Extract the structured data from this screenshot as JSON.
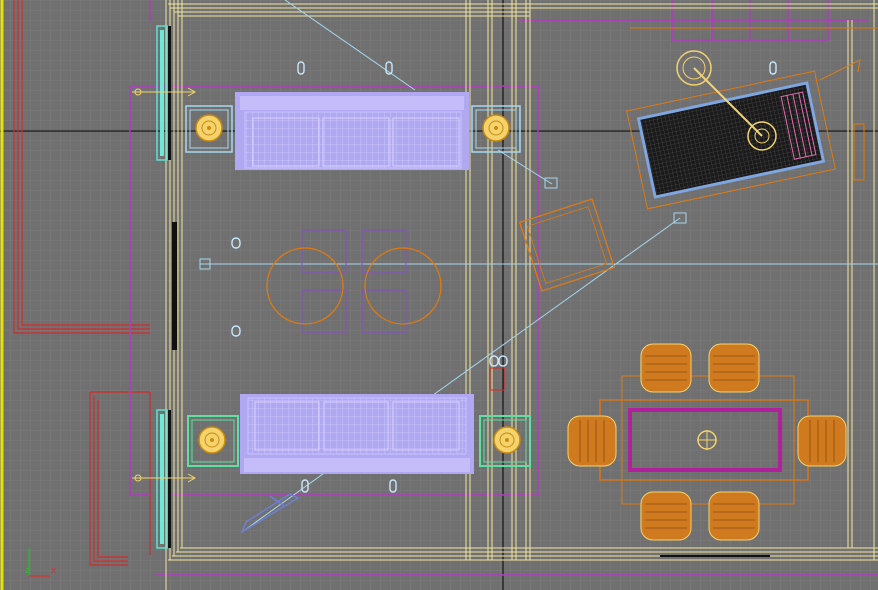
{
  "viewport": {
    "axis_gizmo": {
      "z_label": "z",
      "x_label": "x"
    },
    "colors": {
      "background": "#707070",
      "grid_minor": "#7b7b7b",
      "grid_major": "#000000",
      "wall": "#f3e6a0",
      "wall_outer": "#e0e088",
      "magenta": "#b33ac2",
      "red": "#d62a2a",
      "sofa": "#b0a8f0",
      "lamp": "#f5d36c",
      "orange": "#e07a10",
      "chair": "#d07a20",
      "cyan": "#5fe0d0",
      "light_line": "#a6d8f0",
      "rug": "#111111"
    }
  }
}
